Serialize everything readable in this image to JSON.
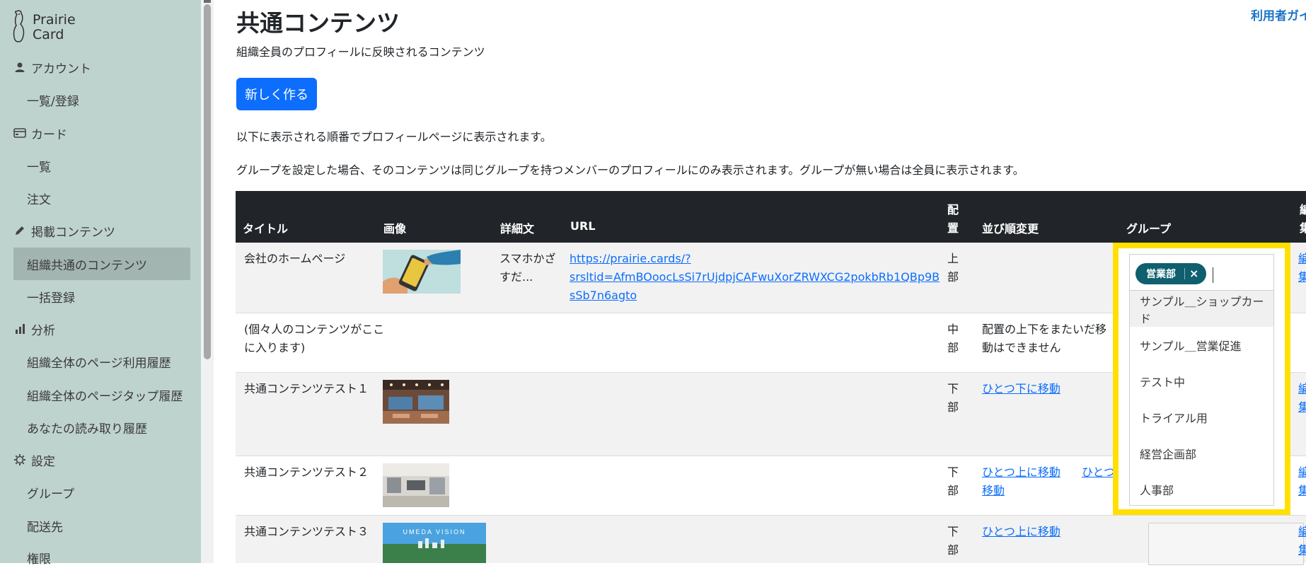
{
  "sidebar": {
    "logo_line1": "Prairie",
    "logo_line2": "Card",
    "account": "アカウント",
    "account_list": "一覧/登録",
    "card": "カード",
    "card_list": "一覧",
    "card_order": "注文",
    "content": "掲載コンテンツ",
    "content_common": "組織共通のコンテンツ",
    "content_bulk": "一括登録",
    "analytics": "分析",
    "analytics_page_usage": "組織全体のページ利用履歴",
    "analytics_page_tap": "組織全体のページタップ履歴",
    "analytics_read": "あなたの読み取り履歴",
    "settings": "設定",
    "settings_group": "グループ",
    "settings_shipping": "配送先",
    "settings_permission": "権限"
  },
  "header": {
    "title": "共通コンテンツ",
    "user_guide": "利用者ガイ",
    "subtitle": "組織全員のプロフィールに反映されるコンテンツ",
    "new_button": "新しく作る",
    "info_order": "以下に表示される順番でプロフィールページに表示されます。",
    "info_group": "グループを設定した場合、そのコンテンツは同じグループを持つメンバーのプロフィールにのみ表示されます。グループが無い場合は全員に表示されます。"
  },
  "table": {
    "headers": {
      "title": "タイトル",
      "image": "画像",
      "detail": "詳細文",
      "url": "URL",
      "placement_1": "配",
      "placement_2": "置",
      "reorder": "並び順変更",
      "group": "グループ",
      "edit_1": "編",
      "edit_2": "集"
    },
    "rows": [
      {
        "title": "会社のホームページ",
        "detail_1": "スマホかざ",
        "detail_2": "すだ...",
        "url_1": "https://prairie.cards/?",
        "url_2": "srsltid=AfmBOoocLsSi7rUjdpjCAFwuXorZRWXCG2pokbRb1QBp9B",
        "url_3": "sSb7n6agto",
        "place_1": "上",
        "place_2": "部",
        "edit_1": "編",
        "edit_2": "集"
      },
      {
        "title_1": "(個々人のコンテンツがここ",
        "title_2": "に入ります)",
        "place_1": "中",
        "place_2": "部",
        "note_1": "配置の上下をまたいだ移",
        "note_2": "動はできません"
      },
      {
        "title": "共通コンテンツテスト１",
        "place_1": "下",
        "place_2": "部",
        "move_down": "ひとつ下に移動",
        "edit_1": "編",
        "edit_2": "集"
      },
      {
        "title": "共通コンテンツテスト２",
        "place_1": "下",
        "place_2": "部",
        "move_up": "ひとつ上に移動",
        "move_down_1": "ひとつ下に",
        "move_down_2": "移動",
        "edit_1": "編",
        "edit_2": "集"
      },
      {
        "title": "共通コンテンツテスト３",
        "place_1": "下",
        "place_2": "部",
        "move_up": "ひとつ上に移動",
        "image_caption": "UMEDA VISION",
        "edit_1": "編",
        "edit_2": "集"
      }
    ]
  },
  "group_select": {
    "selected_tag": "営業部",
    "remove_symbol": "×",
    "options": [
      "サンプル＿ショップカード",
      "サンプル＿営業促進",
      "テスト中",
      "トライアル用",
      "経営企画部",
      "人事部"
    ],
    "highlight_color": "#ffe000",
    "tag_color": "#0f5f6e"
  },
  "colors": {
    "sidebar_bg": "#bfd3ce",
    "sidebar_active": "#a3b5b0",
    "primary": "#0d6efd",
    "table_header": "#212529"
  }
}
